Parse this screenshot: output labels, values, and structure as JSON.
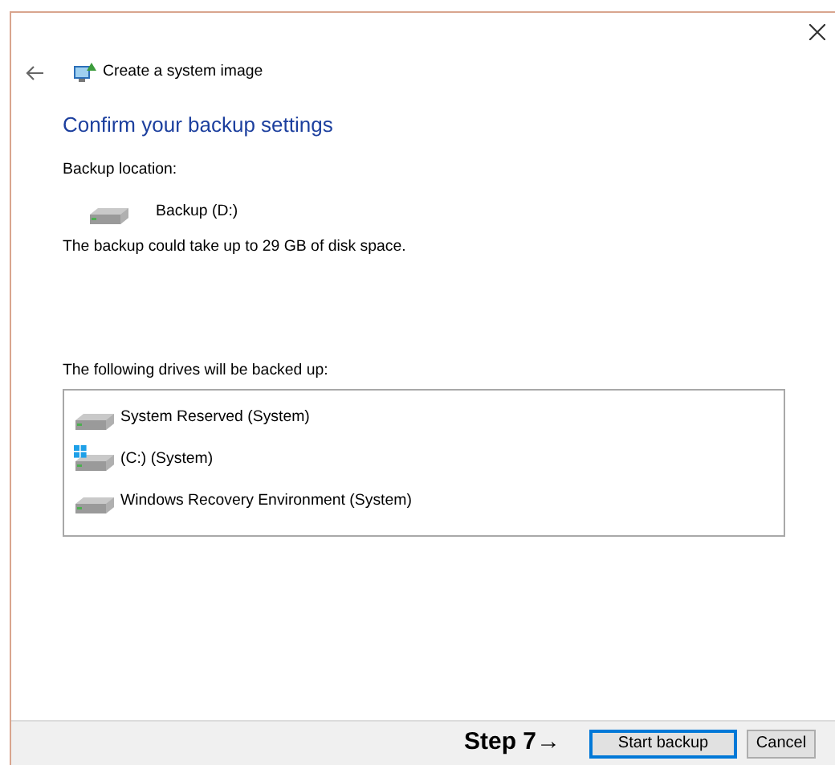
{
  "window": {
    "title": "Create a system image"
  },
  "heading": "Confirm your backup settings",
  "location_label": "Backup location:",
  "location": {
    "label": "Backup (D:)",
    "kind": "drive"
  },
  "space_note": "The backup could take up to 29 GB of disk space.",
  "drives_label": "The following drives will be backed up:",
  "drives": [
    {
      "label": "System Reserved (System)",
      "kind": "drive"
    },
    {
      "label": "(C:) (System)",
      "kind": "system-drive"
    },
    {
      "label": "Windows Recovery Environment (System)",
      "kind": "drive"
    }
  ],
  "annotation": "Step 7→",
  "buttons": [
    {
      "label": "Start backup",
      "default": true
    },
    {
      "label": "Cancel",
      "default": false
    }
  ]
}
